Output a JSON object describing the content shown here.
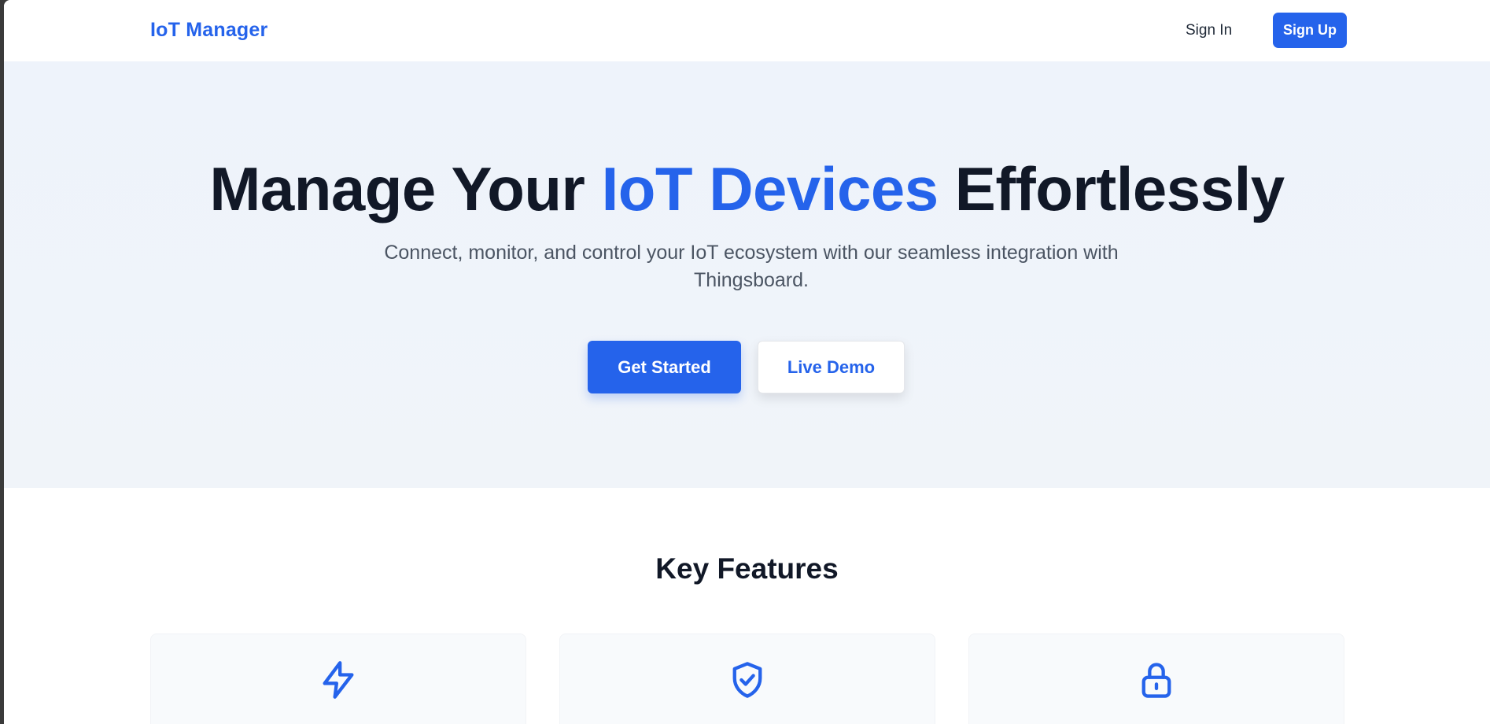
{
  "header": {
    "brand": "IoT Manager",
    "sign_in": "Sign In",
    "sign_up": "Sign Up"
  },
  "hero": {
    "title_part1": "Manage Your ",
    "title_accent": "IoT Devices",
    "title_part2": " Effortlessly",
    "subtitle": "Connect, monitor, and control your IoT ecosystem with our seamless integration with Thingsboard.",
    "primary_button": "Get Started",
    "secondary_button": "Live Demo"
  },
  "features": {
    "title": "Key Features",
    "cards": [
      {
        "icon": "lightning-bolt-icon"
      },
      {
        "icon": "shield-check-icon"
      },
      {
        "icon": "lock-icon"
      }
    ]
  },
  "colors": {
    "accent": "#2563eb",
    "heading": "#111827",
    "body_text": "#4b5563",
    "hero_background": "#eef3fb",
    "card_background": "#f8fafc"
  }
}
